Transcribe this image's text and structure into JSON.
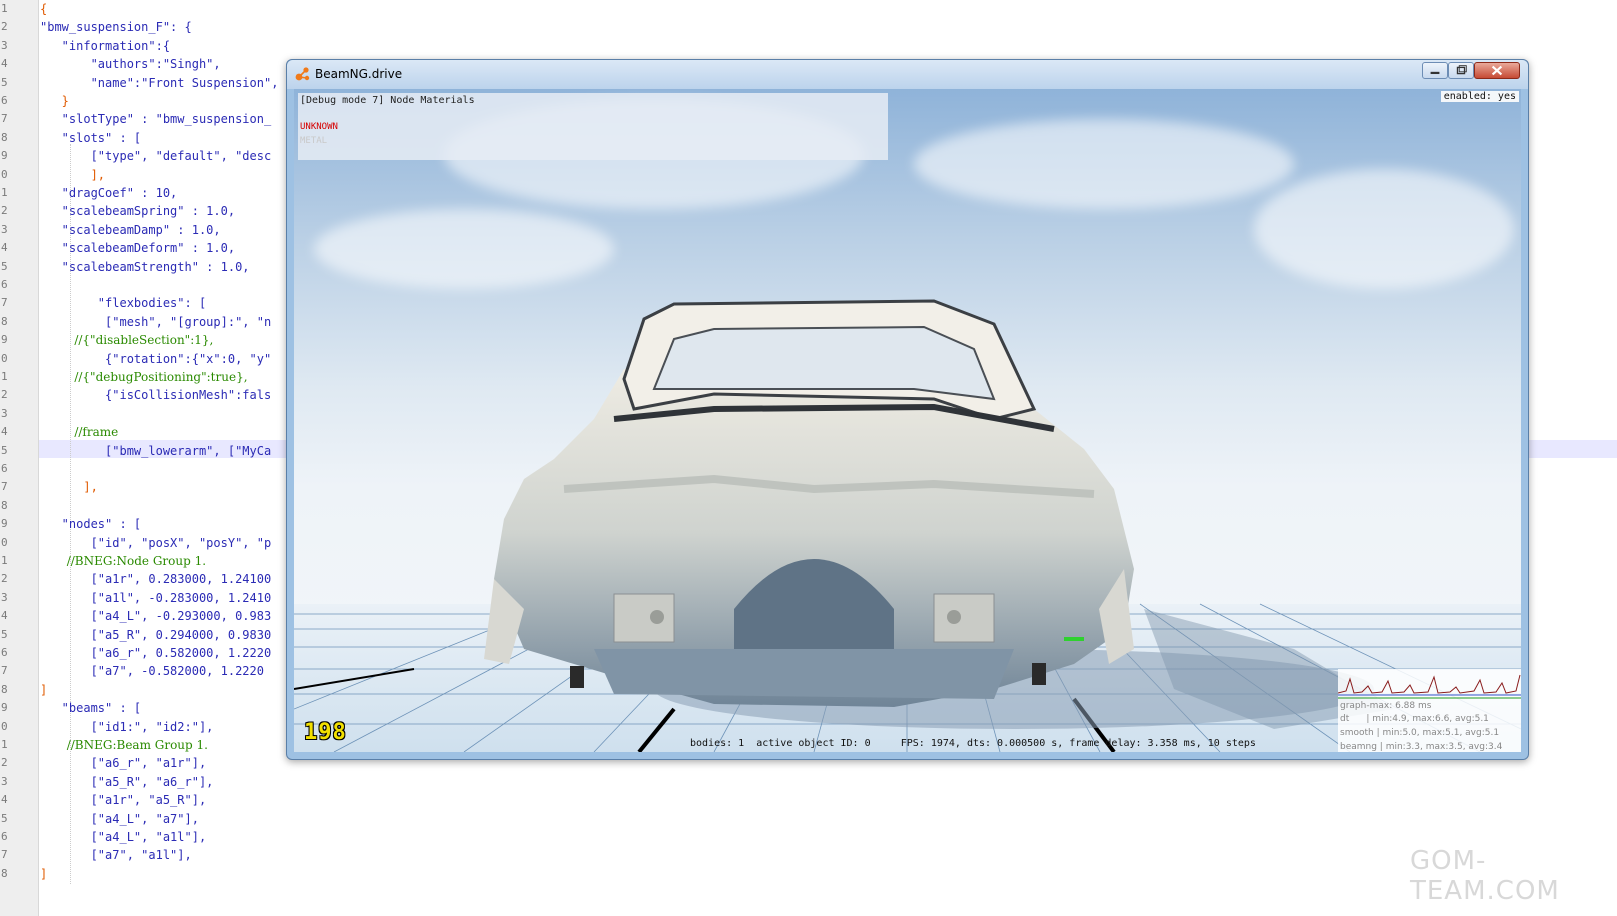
{
  "editor": {
    "line_numbers": [
      "1",
      "2",
      "3",
      "4",
      "5",
      "6",
      "7",
      "8",
      "9",
      "0",
      "1",
      "2",
      "3",
      "4",
      "5",
      "6",
      "7",
      "8",
      "9",
      "0",
      "1",
      "2",
      "3",
      "4",
      "5",
      "6",
      "7",
      "8",
      "9",
      "0",
      "1",
      "2",
      "3",
      "4",
      "5",
      "6",
      "7",
      "8",
      "9",
      "0",
      "1",
      "2",
      "3",
      "4",
      "5",
      "6",
      "7",
      "8"
    ],
    "lines": [
      "{",
      "\"bmw_suspension_F\": {",
      "   \"information\":{",
      "       \"authors\":\"Singh\",",
      "       \"name\":\"Front Suspension\",",
      "   }",
      "   \"slotType\" : \"bmw_suspension_",
      "   \"slots\" : [",
      "       [\"type\", \"default\", \"desc",
      "       ],",
      "   \"dragCoef\" : 10,",
      "   \"scalebeamSpring\" : 1.0,",
      "   \"scalebeamDamp\" : 1.0,",
      "   \"scalebeamDeform\" : 1.0,",
      "   \"scalebeamStrength\" : 1.0,",
      "",
      "        \"flexbodies\": [",
      "         [\"mesh\", \"[group]:\", \"n",
      "         //{\"disableSection\":1},",
      "         {\"rotation\":{\"x\":0, \"y\"",
      "         //{\"debugPositioning\":true},",
      "         {\"isCollisionMesh\":fals",
      "",
      "         //frame",
      "         [\"bmw_lowerarm\", [\"MyCa",
      "",
      "      ],",
      "",
      "   \"nodes\" : [",
      "       [\"id\", \"posX\", \"posY\", \"p",
      "       //BNEG:Node Group 1.",
      "       [\"a1r\", 0.283000, 1.24100",
      "       [\"a1l\", -0.283000, 1.2410",
      "       [\"a4_L\", -0.293000, 0.983",
      "       [\"a5_R\", 0.294000, 0.9830",
      "       [\"a6_r\", 0.582000, 1.2220",
      "       [\"a7\", -0.582000, 1.2220",
      "]",
      "   \"beams\" : [",
      "       [\"id1:\", \"id2:\"],",
      "       //BNEG:Beam Group 1.",
      "       [\"a6_r\", \"a1r\"],",
      "       [\"a5_R\", \"a6_r\"],",
      "       [\"a1r\", \"a5_R\"],",
      "       [\"a4_L\", \"a7\"],",
      "       [\"a4_L\", \"a1l\"],",
      "       [\"a7\", \"a1l\"],",
      "]"
    ]
  },
  "window": {
    "title": "BeamNG.drive",
    "icon": "beamng-logo-icon"
  },
  "debug": {
    "mode_title": "[Debug mode 7] Node Materials",
    "legend_unknown": "UNKNOWN",
    "legend_metal": "METAL",
    "enabled": "enabled: yes"
  },
  "stats": {
    "bar": "bodies: 1  active object ID: 0     FPS: 1974, dts: 0.000500 s, frame delay: 3.358 ms, 10 steps",
    "fps_digits": "198",
    "graph_max": "graph-max: 6.88 ms",
    "dt": "dt      | min:4.9, max:6.6, avg:5.1",
    "smooth": "smooth | min:5.0, max:5.1, avg:5.1",
    "beamng": "beamng | min:3.3, max:3.5, avg:3.4"
  },
  "watermark": "GOM-TEAM.COM",
  "colors": {
    "title_bar": "#bcd3ec",
    "close_button": "#c64a34",
    "unknown_red": "#d60000",
    "fps_yellow": "#f2e000"
  }
}
